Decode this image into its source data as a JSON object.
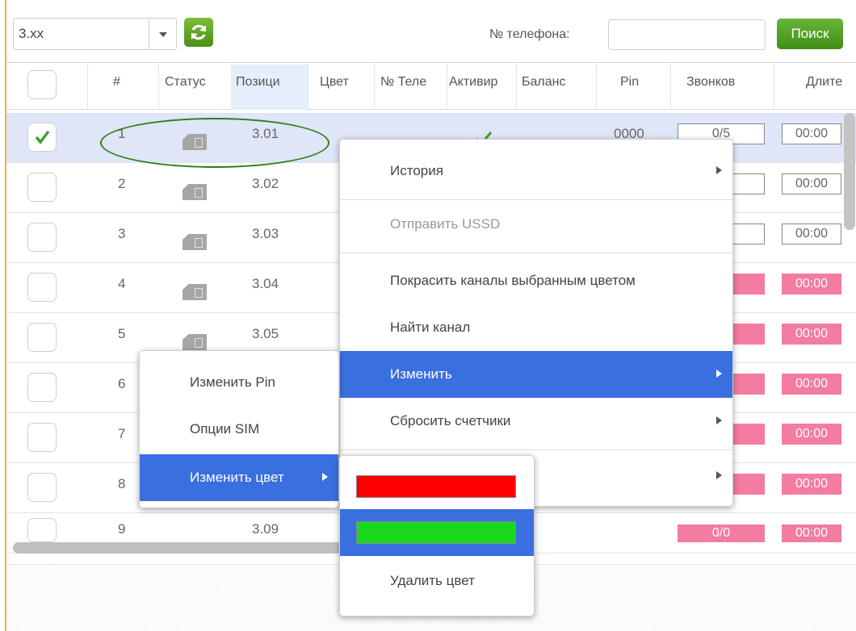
{
  "toolbar": {
    "position_filter": "3.xx",
    "phone_label": "№ телефона:",
    "phone_value": "",
    "search_label": "Поиск"
  },
  "columns": [
    "#",
    "Статус",
    "Позици",
    "Цвет",
    "№ Теле",
    "Активир",
    "Баланс",
    "Pin",
    "Звонков",
    "Длите"
  ],
  "rows": [
    {
      "num": "1",
      "position": "3.01",
      "pin": "0000",
      "calls": "0/5",
      "duration": "00:00",
      "checked": true,
      "active": true
    },
    {
      "num": "2",
      "position": "3.02",
      "duration": "00:00"
    },
    {
      "num": "3",
      "position": "3.03",
      "duration": "00:00"
    },
    {
      "num": "4",
      "position": "3.04",
      "duration": "00:00"
    },
    {
      "num": "5",
      "position": "3.05",
      "duration": "00:00"
    },
    {
      "num": "6",
      "position": "",
      "duration": "00:00"
    },
    {
      "num": "7",
      "position": "",
      "duration": "00:00"
    },
    {
      "num": "8",
      "position": "",
      "duration": "00:00"
    },
    {
      "num": "9",
      "position": "3.09",
      "calls": "0/0",
      "duration": "00:00"
    }
  ],
  "context_menu": {
    "items": [
      "История",
      "Отправить USSD",
      "Покрасить каналы выбранным цветом",
      "Найти канал",
      "Изменить",
      "Сбросить счетчики"
    ]
  },
  "edit_submenu": {
    "items": [
      "Изменить Pin",
      "Опции SIM",
      "Изменить цвет"
    ]
  },
  "color_submenu": {
    "colors": [
      "#ff0000",
      "#19d81e"
    ],
    "remove_label": "Удалить цвет"
  },
  "colors": {
    "accent": "#3a6fe0",
    "row_selected": "#dfe6f7",
    "pink_cell": "#f37ca0",
    "button_green": "#4c9a1f"
  }
}
